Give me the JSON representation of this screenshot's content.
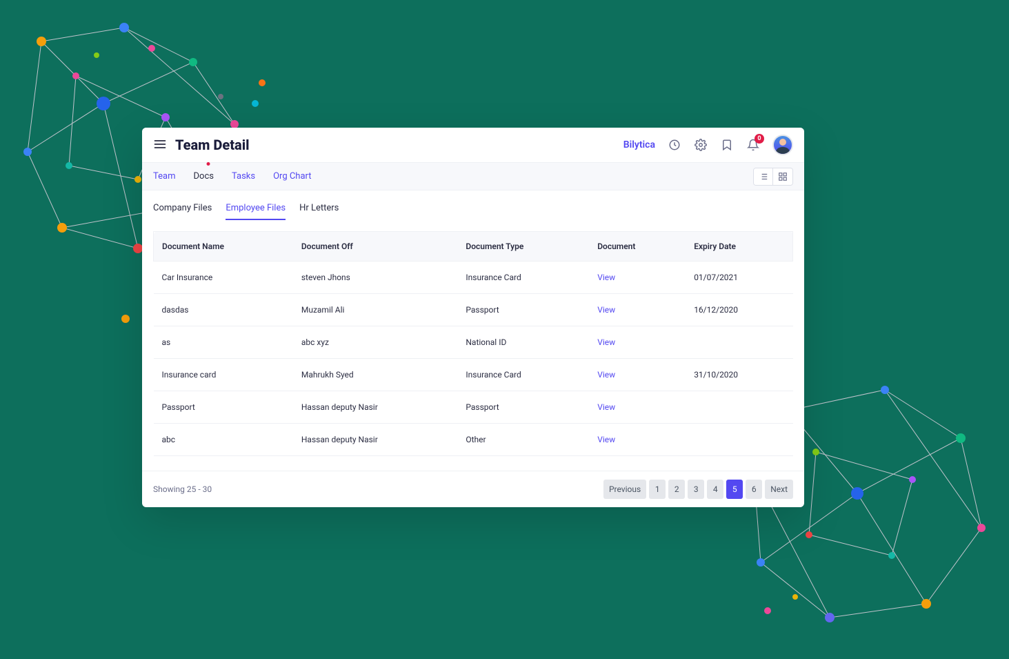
{
  "header": {
    "title": "Team Detail",
    "brand": "Bilytica",
    "notificationCount": "0"
  },
  "navTabs": [
    {
      "label": "Team",
      "active": false
    },
    {
      "label": "Docs",
      "active": true
    },
    {
      "label": "Tasks",
      "active": false
    },
    {
      "label": "Org Chart",
      "active": false
    }
  ],
  "subTabs": [
    {
      "label": "Company Files",
      "active": false
    },
    {
      "label": "Employee Files",
      "active": true
    },
    {
      "label": "Hr Letters",
      "active": false
    }
  ],
  "table": {
    "columns": [
      "Document Name",
      "Document Off",
      "Document Type",
      "Document",
      "Expiry Date"
    ],
    "viewLabel": "View",
    "rows": [
      {
        "name": "Car Insurance",
        "off": "steven Jhons",
        "type": "Insurance Card",
        "expiry": "01/07/2021"
      },
      {
        "name": "dasdas",
        "off": "Muzamil Ali",
        "type": "Passport",
        "expiry": "16/12/2020"
      },
      {
        "name": "as",
        "off": "abc xyz",
        "type": "National ID",
        "expiry": ""
      },
      {
        "name": "Insurance card",
        "off": "Mahrukh Syed",
        "type": "Insurance Card",
        "expiry": "31/10/2020"
      },
      {
        "name": "Passport",
        "off": "Hassan deputy Nasir",
        "type": "Passport",
        "expiry": ""
      },
      {
        "name": "abc",
        "off": "Hassan deputy Nasir",
        "type": "Other",
        "expiry": ""
      }
    ]
  },
  "pagination": {
    "showing": "Showing 25 - 30",
    "previous": "Previous",
    "next": "Next",
    "pages": [
      "1",
      "2",
      "3",
      "4",
      "5",
      "6"
    ],
    "activePage": "5"
  }
}
